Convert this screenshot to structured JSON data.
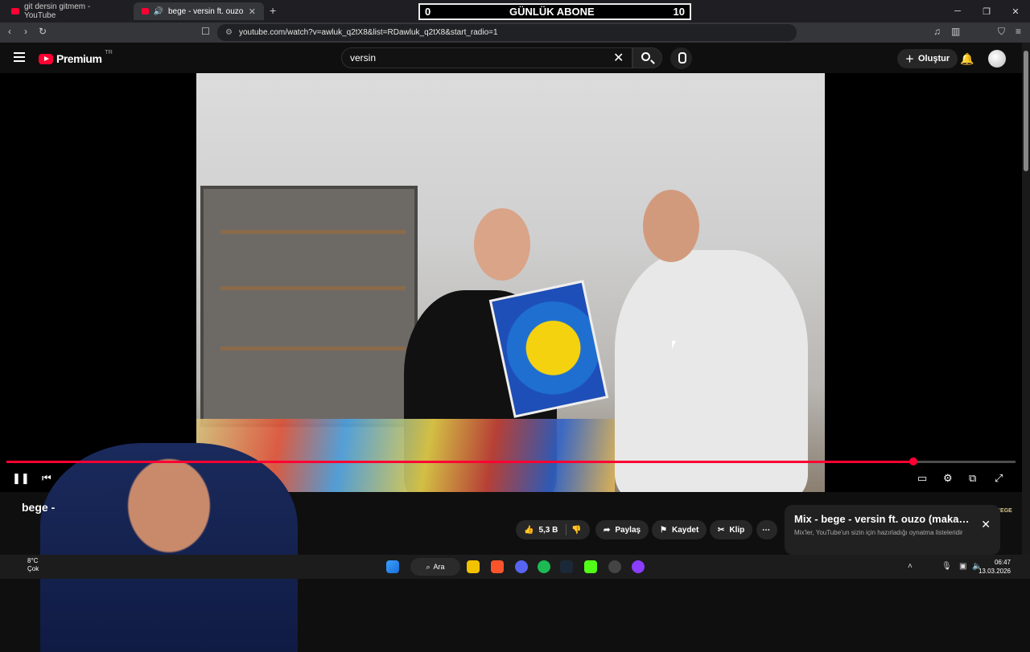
{
  "browser": {
    "tabs": [
      {
        "title": "git dersin gitmem - YouTube",
        "active": false
      },
      {
        "title": "bege - versin ft. ouzo (makar…",
        "active": true
      }
    ],
    "url": "youtube.com/watch?v=awluk_q2tX8&list=RDawluk_q2tX8&start_radio=1"
  },
  "counter": {
    "left": "0",
    "label": "GÜNLÜK ABONE",
    "right": "10"
  },
  "youtube": {
    "logo": "Premium",
    "region": "TR",
    "search_value": "versin",
    "create_label": "Oluştur"
  },
  "player": {
    "watermark": "BEGE",
    "progress_fraction": 0.899
  },
  "video": {
    "title": "bege -",
    "likes": "5,3 B",
    "share_label": "Paylaş",
    "save_label": "Kaydet",
    "clip_label": "Klip"
  },
  "mix": {
    "title": "Mix - bege - versin ft. ouzo (makara...",
    "subtitle": "Mix'ler, YouTube'un sizin için hazırladığı oynatma listeleridir"
  },
  "taskbar": {
    "temp": "8°C",
    "weather": "Çok",
    "search_label": "Ara",
    "time": "06:47",
    "date": "13.03.2026"
  },
  "colors": {
    "accent": "#ff0033",
    "bg": "#0f0f0f"
  }
}
